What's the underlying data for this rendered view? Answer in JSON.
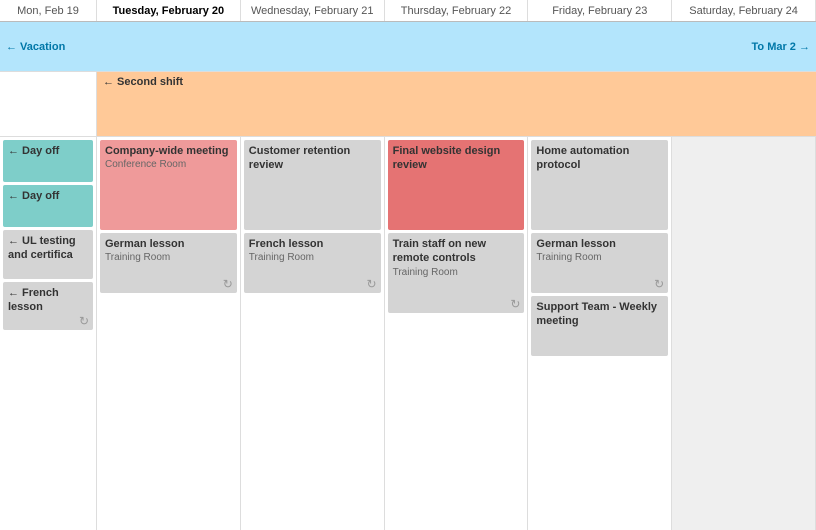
{
  "header": {
    "cols": [
      {
        "label": "Mon, Feb 19",
        "today": false
      },
      {
        "label": "Tuesday, February 20",
        "today": true
      },
      {
        "label": "Wednesday, February 21",
        "today": false
      },
      {
        "label": "Thursday, February 22",
        "today": false
      },
      {
        "label": "Friday, February 23",
        "today": false
      },
      {
        "label": "Saturday, February 24",
        "today": false
      }
    ]
  },
  "vacation": {
    "label_left": "← Vacation",
    "label_right": "To Mar 2 →"
  },
  "second_shift": {
    "label": "← Second shift"
  },
  "events": {
    "mon": [
      {
        "type": "dayoff",
        "title": "← Day off"
      },
      {
        "type": "dayoff",
        "title": "← Day off"
      },
      {
        "type": "gray",
        "title": "← UL testing and certifica"
      },
      {
        "type": "gray",
        "title": "← French lesson",
        "has_refresh": true
      }
    ],
    "tue": [
      {
        "type": "pink-bold",
        "title": "Company-wide meeting",
        "sub": "Conference Room"
      }
    ],
    "wed": [
      {
        "type": "gray",
        "title": "Customer retention review"
      },
      {
        "type": "gray",
        "title": "German lesson",
        "sub": "Training Room",
        "has_refresh": true
      },
      {
        "type": "gray",
        "title": "French lesson",
        "sub": "Training Room",
        "has_refresh": true
      }
    ],
    "thu": [
      {
        "type": "salmon",
        "title": "Final website design review"
      },
      {
        "type": "gray",
        "title": "Train staff on new remote controls",
        "sub": "Training Room"
      }
    ],
    "fri": [
      {
        "type": "gray",
        "title": "Home automation protocol"
      },
      {
        "type": "gray",
        "title": "German lesson",
        "sub": "Training Room",
        "has_refresh": true
      },
      {
        "type": "gray",
        "title": "Support Team - Weekly meeting"
      }
    ],
    "sat": []
  },
  "icons": {
    "refresh": "↻",
    "arrow_left": "←",
    "arrow_right": "→"
  }
}
